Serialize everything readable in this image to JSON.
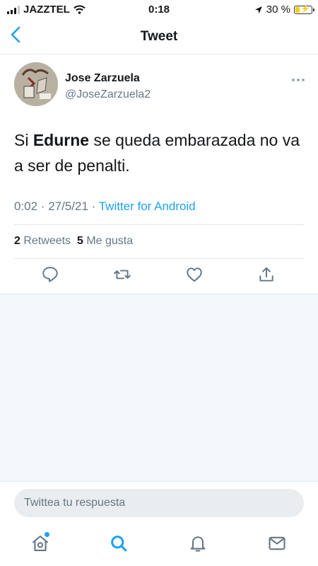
{
  "status_bar": {
    "carrier": "JAZZTEL",
    "time": "0:18",
    "battery": "30 %",
    "battery_level": 0.3
  },
  "nav": {
    "title": "Tweet",
    "back_icon": "chevron-left-icon"
  },
  "tweet": {
    "author_name": "Jose Zarzuela",
    "author_handle": "@JoseZarzuela2",
    "text_before": "Si ",
    "text_bold": "Edurne",
    "text_after": " se queda embarazada no va a ser de penalti.",
    "timestamp": "0:02 · 27/5/21 · ",
    "source": "Twitter for Android",
    "retweets_count": "2",
    "retweets_label": "Retweets",
    "likes_count": "5",
    "likes_label": "Me gusta"
  },
  "actions": [
    "reply-icon",
    "retweet-icon",
    "like-icon",
    "share-icon"
  ],
  "reply": {
    "placeholder": "Twittea tu respuesta"
  },
  "tabbar": {
    "tabs": [
      "home-icon",
      "search-icon",
      "notifications-icon",
      "messages-icon"
    ],
    "active": "search-icon"
  },
  "colors": {
    "accent": "#1da1f2",
    "secondary_text": "#657786",
    "background_gray": "#f5f8fa"
  }
}
